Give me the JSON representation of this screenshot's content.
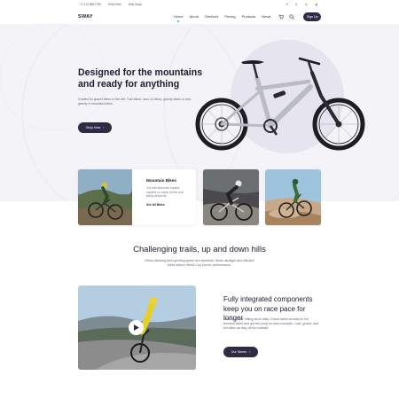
{
  "topbar": {
    "phone": "+1 212 868 1750",
    "link_1": "Help Desk",
    "link_2": "Why Sway",
    "socials": [
      {
        "icon": "facebook-icon",
        "glyph": "f"
      },
      {
        "icon": "twitter-icon",
        "glyph": "t"
      },
      {
        "icon": "instagram-icon",
        "glyph": "◎"
      },
      {
        "icon": "pinterest-icon",
        "glyph": "p"
      }
    ]
  },
  "nav": {
    "logo": "SWAY",
    "menu": [
      "Home",
      "About",
      "Services",
      "Pricing",
      "Products",
      "News"
    ],
    "active": "Home",
    "signup": "Sign Up"
  },
  "hero": {
    "title": "Designed for the mountains and ready for anything",
    "text": "Crafted for gravel bikes in the dirt. Trail bikes, race xc bikes, gravity bikes or anti-gravity e-mountain bikes.",
    "button": "Shop Now"
  },
  "cards": {
    "main": {
      "title": "Mountain Bikes",
      "text": "Our trail bikes are equally capable on steep climbs and twisty descents.",
      "link": "See All Bikes"
    }
  },
  "section": {
    "title": "Challenging trails, up and down hills",
    "text": "When climbing and sprinting speed are essential, these ultralight and efficient bikes deliver World Cup proven performance."
  },
  "feature": {
    "title": "Fully integrated components keep you on race pace for longer",
    "text": "New bikes are hitting stock daily. Check latest arrivals for the freshest bikes and get the jump on new mountain, road, gravel, and kid bikes as they hit the website.",
    "button": "Our Stores"
  },
  "colors": {
    "accent": "#2e2b45",
    "hero_bg": "#f4f3f8",
    "active_dot": "#2bb673"
  }
}
